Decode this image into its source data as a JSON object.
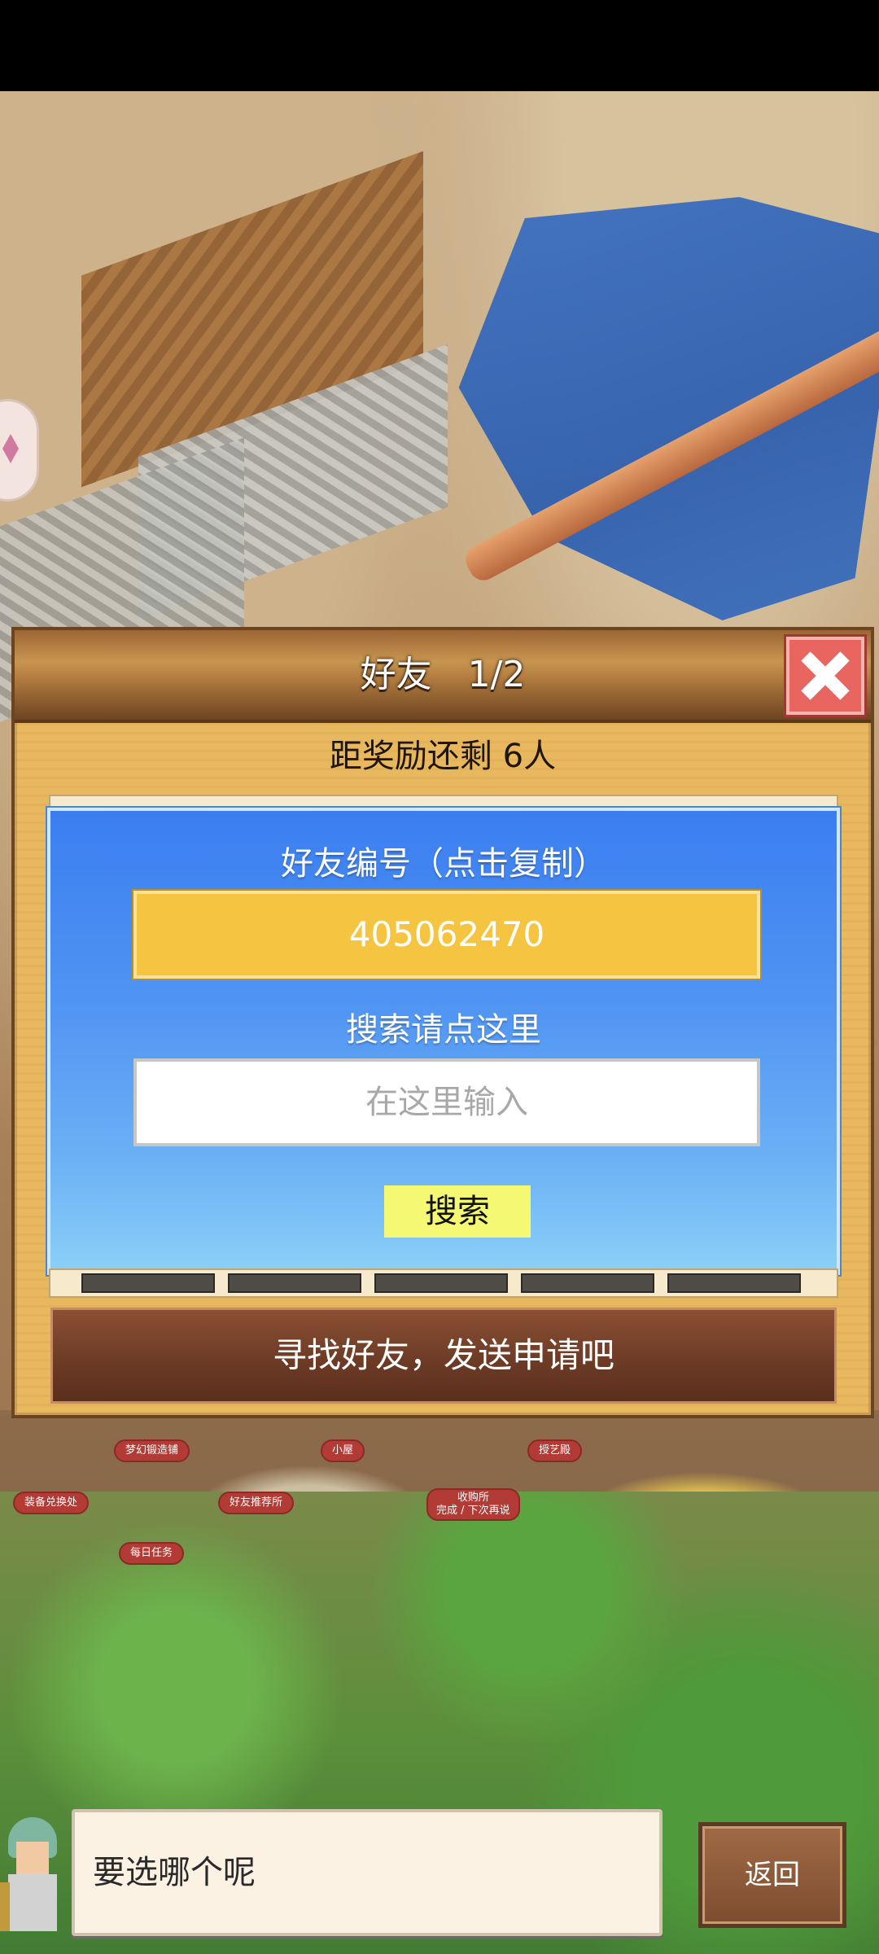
{
  "dialog": {
    "title": "好友　1/2",
    "reward_text": "距奖励还剩 6人",
    "friend_id_label": "好友编号（点击复制）",
    "friend_id": "405062470",
    "search_label": "搜索请点这里",
    "search_placeholder": "在这里输入",
    "search_button": "搜索",
    "find_friends_button": "寻找好友，发送申请吧"
  },
  "map_labels": {
    "dream_forge": "梦幻锻造铺",
    "hut": "小屋",
    "arts_hall": "授艺殿",
    "equipment_exchange": "装备兑换处",
    "friend_referral": "好友推荐所",
    "purchase_station": "收购所",
    "purchase_station_sub": "完成 / 下次再说",
    "daily_quest": "每日任务"
  },
  "bottom": {
    "message": "要选哪个呢",
    "back_button": "返回"
  },
  "colors": {
    "panel_blue": "#3b7ef0",
    "id_box_yellow": "#f5c542",
    "search_button_yellow": "#f4f872",
    "close_red": "#e86560",
    "find_button_brown": "#6b3a25"
  },
  "icons": [
    "close-icon",
    "left-arrow-icon",
    "right-arrow-icon",
    "character-avatar"
  ]
}
